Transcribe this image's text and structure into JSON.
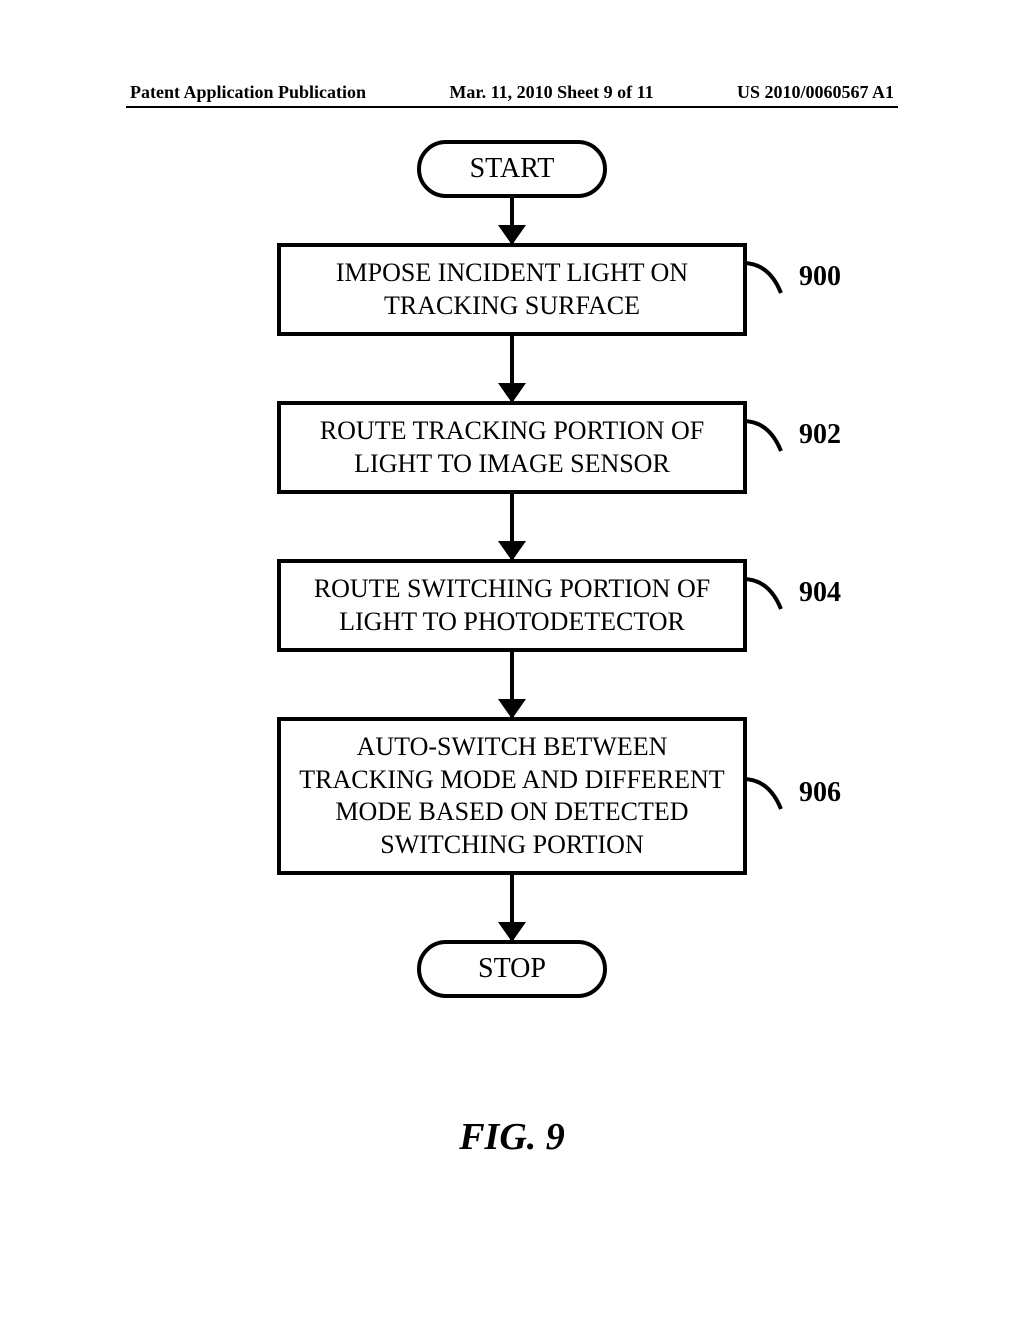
{
  "header": {
    "left": "Patent Application Publication",
    "center": "Mar. 11, 2010  Sheet 9 of 11",
    "right": "US 2010/0060567 A1"
  },
  "flowchart": {
    "start": "START",
    "steps": [
      {
        "label": "IMPOSE INCIDENT LIGHT ON TRACKING SURFACE",
        "ref": "900"
      },
      {
        "label": "ROUTE TRACKING PORTION OF LIGHT TO IMAGE SENSOR",
        "ref": "902"
      },
      {
        "label": "ROUTE SWITCHING PORTION OF LIGHT TO PHOTODETECTOR",
        "ref": "904"
      },
      {
        "label": "AUTO-SWITCH BETWEEN TRACKING MODE AND DIFFERENT MODE BASED ON DETECTED SWITCHING PORTION",
        "ref": "906"
      }
    ],
    "stop": "STOP"
  },
  "caption": "FIG. 9"
}
